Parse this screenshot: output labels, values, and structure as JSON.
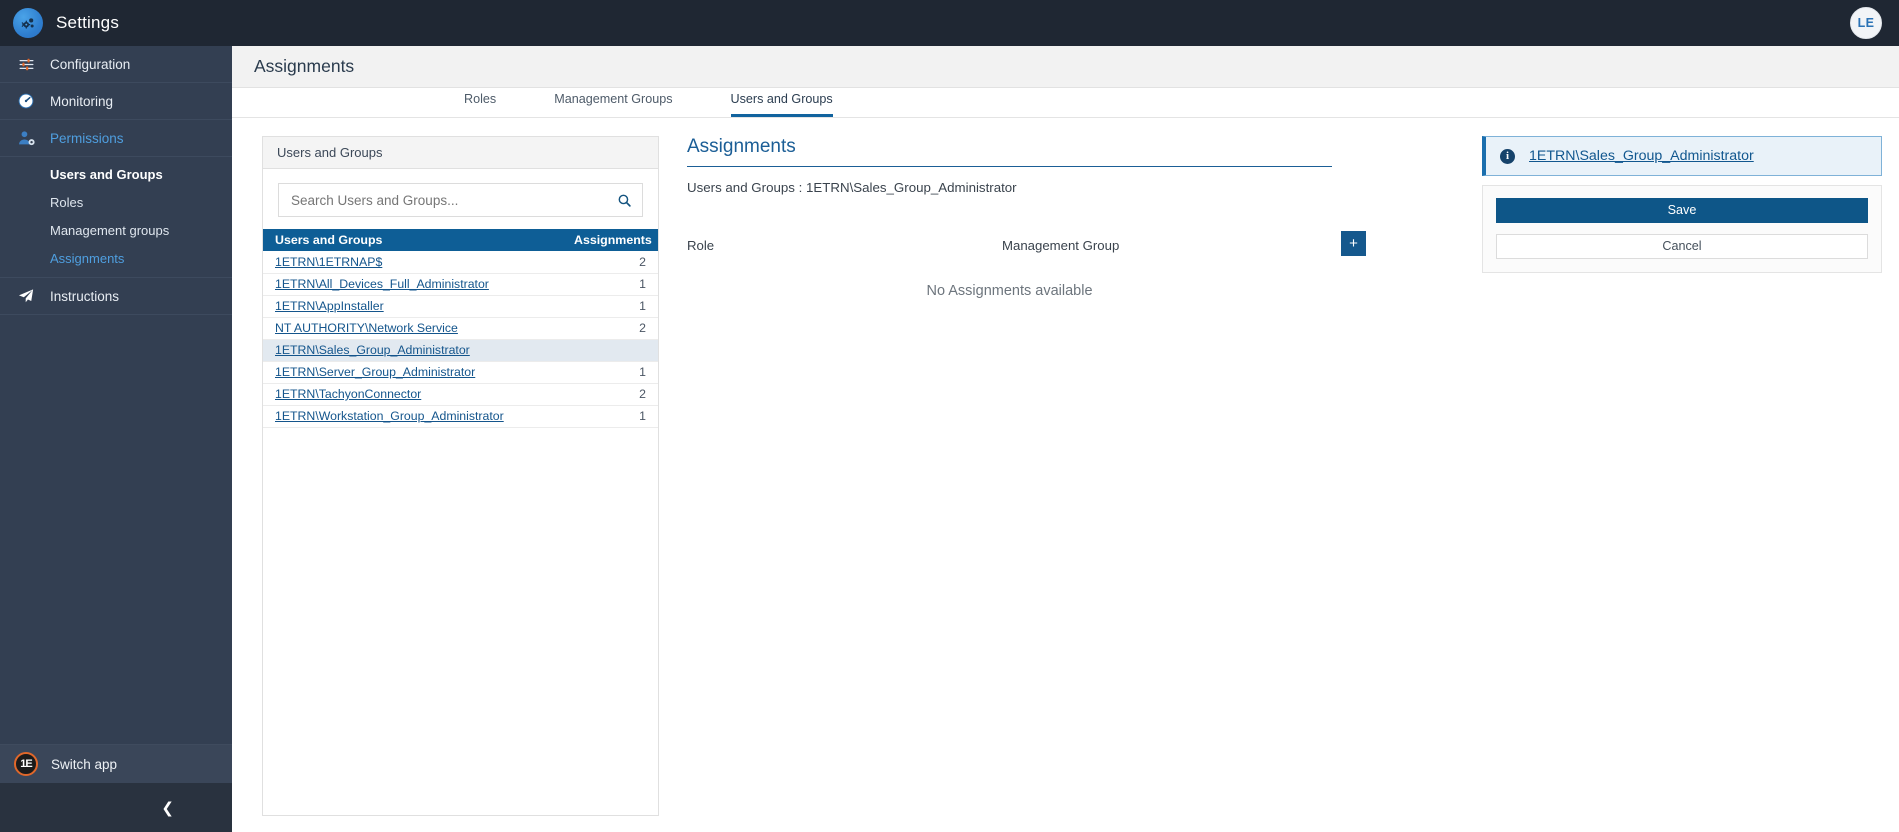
{
  "topbar": {
    "logo_icon": "gears-icon",
    "title": "Settings",
    "avatar_initials": "LE"
  },
  "sidebar": {
    "items": [
      {
        "label": "Configuration",
        "icon": "sliders-icon",
        "state": "default"
      },
      {
        "label": "Monitoring",
        "icon": "gauge-icon",
        "state": "default"
      },
      {
        "label": "Permissions",
        "icon": "user-gear-icon",
        "state": "active-parent"
      },
      {
        "label": "Instructions",
        "icon": "paper-plane-icon",
        "state": "default"
      }
    ],
    "sub_items": [
      {
        "label": "Users and Groups",
        "state": "bold"
      },
      {
        "label": "Roles",
        "state": "default"
      },
      {
        "label": "Management groups",
        "state": "default"
      },
      {
        "label": "Assignments",
        "state": "selected"
      }
    ],
    "switch_app": {
      "label": "Switch app",
      "logo_text": "1E"
    },
    "collapse_icon": "chevron-left-icon"
  },
  "header": {
    "page_title": "Assignments"
  },
  "tabs": [
    {
      "label": "Roles",
      "active": false
    },
    {
      "label": "Management Groups",
      "active": false
    },
    {
      "label": "Users and Groups",
      "active": true
    }
  ],
  "users_panel": {
    "card_title": "Users and Groups",
    "search": {
      "placeholder": "Search Users and Groups...",
      "value": "",
      "icon": "search-icon"
    },
    "columns": [
      "Users and Groups",
      "Assignments"
    ],
    "rows": [
      {
        "name": "1ETRN\\1ETRNAP$",
        "assignments": "2",
        "selected": false
      },
      {
        "name": "1ETRN\\All_Devices_Full_Administrator",
        "assignments": "1",
        "selected": false
      },
      {
        "name": "1ETRN\\AppInstaller",
        "assignments": "1",
        "selected": false
      },
      {
        "name": "NT AUTHORITY\\Network Service",
        "assignments": "2",
        "selected": false
      },
      {
        "name": "1ETRN\\Sales_Group_Administrator",
        "assignments": "",
        "selected": true
      },
      {
        "name": "1ETRN\\Server_Group_Administrator",
        "assignments": "1",
        "selected": false
      },
      {
        "name": "1ETRN\\TachyonConnector",
        "assignments": "2",
        "selected": false
      },
      {
        "name": "1ETRN\\Workstation_Group_Administrator",
        "assignments": "1",
        "selected": false
      }
    ]
  },
  "detail": {
    "title": "Assignments",
    "subtitle": "Users and Groups : 1ETRN\\Sales_Group_Administrator",
    "column_role": "Role",
    "column_management_group": "Management Group",
    "add_button_label": "+",
    "empty_message": "No Assignments available"
  },
  "rail": {
    "info": {
      "icon": "info-icon",
      "link_text": "1ETRN\\Sales_Group_Administrator"
    },
    "save_label": "Save",
    "cancel_label": "Cancel"
  },
  "colors": {
    "topbar_bg": "#1f2733",
    "sidebar_bg": "#333f52",
    "accent_blue": "#11639e",
    "table_header_bg": "#0e5e96",
    "link_blue": "#14558c",
    "selected_row_bg": "#e2e9f0",
    "info_box_bg": "#e9f2f9",
    "save_button_bg": "#0e5688",
    "switch_app_orange": "#e0672a"
  }
}
